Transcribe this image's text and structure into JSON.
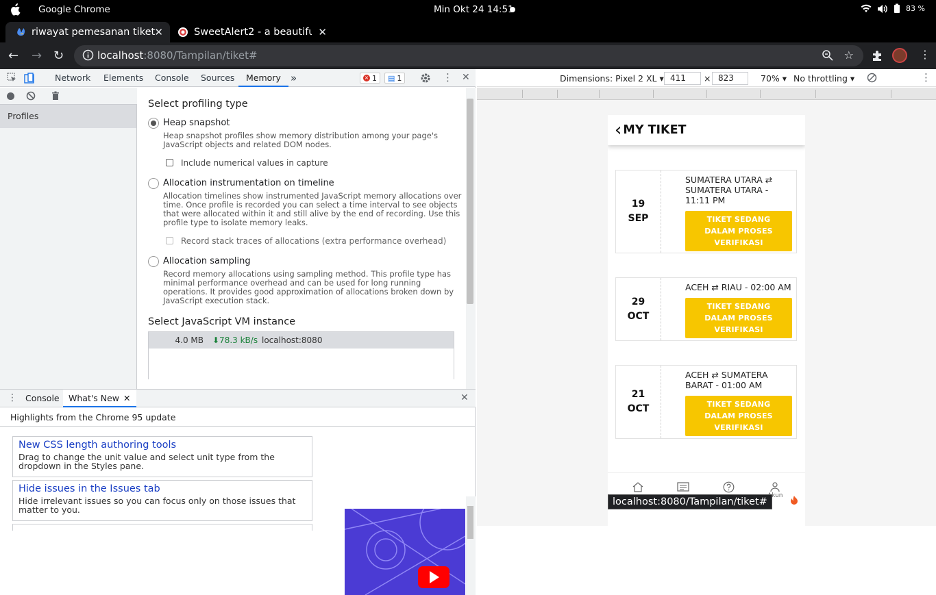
{
  "os_bar": {
    "app_name": "Google Chrome",
    "clock": "Min Okt 24  14:51",
    "battery": "83 %"
  },
  "tabs": [
    {
      "title": "riwayat pemesanan tiket",
      "active": true
    },
    {
      "title": "SweetAlert2 - a beautiful, ",
      "active": false
    }
  ],
  "address": {
    "host": "localhost",
    "rest": ":8080/Tampilan/tiket#"
  },
  "devtools": {
    "tabs": [
      "Network",
      "Elements",
      "Console",
      "Sources",
      "Memory"
    ],
    "active_tab": "Memory",
    "more": "»",
    "error_count": "1",
    "message_count": "1",
    "sidebar_item": "Profiles",
    "memory": {
      "heading": "Select profiling type",
      "options": [
        {
          "label": "Heap snapshot",
          "desc": "Heap snapshot profiles show memory distribution among your page's JavaScript objects and related DOM nodes.",
          "selected": true
        },
        {
          "label": "Allocation instrumentation on timeline",
          "desc": "Allocation timelines show instrumented JavaScript memory allocations over time. Once profile is recorded you can select a time interval to see objects that were allocated within it and still alive by the end of recording. Use this profile type to isolate memory leaks.",
          "selected": false
        },
        {
          "label": "Allocation sampling",
          "desc": "Record memory allocations using sampling method. This profile type has minimal performance overhead and can be used for long running operations. It provides good approximation of allocations broken down by JavaScript execution stack.",
          "selected": false
        }
      ],
      "check1": "Include numerical values in capture",
      "check2": "Record stack traces of allocations (extra performance overhead)",
      "vm_heading": "Select JavaScript VM instance",
      "vm": {
        "size": "4.0 MB",
        "rate": "⬇78.3 kB/s",
        "host": "localhost:8080"
      }
    },
    "drawer": {
      "tabs": [
        "Console",
        "What's New"
      ],
      "active": "What's New",
      "heading": "Highlights from the Chrome 95 update",
      "cards": [
        {
          "title": "New CSS length authoring tools",
          "desc": "Drag to change the unit value and select unit type from the dropdown in the Styles pane."
        },
        {
          "title": "Hide issues in the Issues tab",
          "desc": "Hide irrelevant issues so you can focus only on those issues that matter to you."
        }
      ]
    }
  },
  "device_bar": {
    "dimensions": "Dimensions: Pixel 2 XL",
    "width": "411",
    "x": "×",
    "height": "823",
    "zoom": "70%",
    "throttle": "No throttling"
  },
  "phone": {
    "back": "‹",
    "title": "MY TIKET",
    "tickets": [
      {
        "day": "19",
        "month": "SEP",
        "route": "SUMATERA UTARA ⇄ SUMATERA UTARA - 11:11 PM",
        "status": "TIKET SEDANG DALAM PROSES VERIFIKASI"
      },
      {
        "day": "29",
        "month": "OCT",
        "route": "ACEH ⇄ RIAU - 02:00 AM",
        "status": "TIKET SEDANG DALAM PROSES VERIFIKASI"
      },
      {
        "day": "21",
        "month": "OCT",
        "route": "ACEH ⇄ SUMATERA BARAT - 01:00 AM",
        "status": "TIKET SEDANG DALAM PROSES VERIFIKASI"
      }
    ],
    "nav_label": "Akun"
  },
  "status_url": "localhost:8080/Tampilan/tiket#",
  "colors": {
    "accent": "#1a73e8",
    "ticket_button": "#f7c600",
    "video_bg": "#4b3bd4"
  }
}
